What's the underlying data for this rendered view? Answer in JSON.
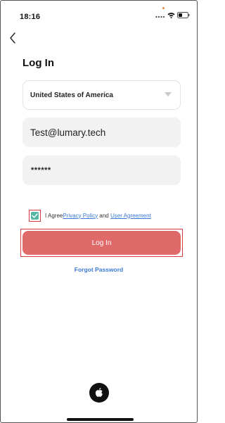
{
  "status_bar": {
    "time": "18:16"
  },
  "page": {
    "title": "Log In"
  },
  "form": {
    "country": "United States of America",
    "email": "Test@lumary.tech",
    "password": "******"
  },
  "agreement": {
    "checked": true,
    "prefix": "I Agree",
    "privacy_link": "Privacy Policy",
    "conjunction": "and",
    "user_agreement_link": "User Agreement"
  },
  "actions": {
    "login_label": "Log In",
    "forgot_label": "Forgot Password"
  },
  "social": {
    "icon": "apple-icon"
  },
  "colors": {
    "accent": "#e06a6a",
    "link": "#3b7bd6",
    "checkbox": "#56b6a4",
    "highlight": "#d9363e"
  }
}
